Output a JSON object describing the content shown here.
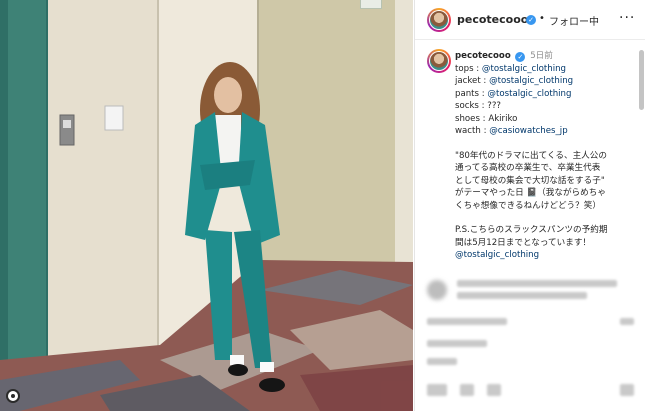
{
  "post": {
    "username": "pecotecooo",
    "follow_separator": "•",
    "follow_label": "フォロー中",
    "more_label": "···",
    "verified_mark": "✓"
  },
  "caption": {
    "username": "pecotecooo",
    "time": "5日前",
    "lines": [
      {
        "key": "tops : ",
        "value": "@tostalgic_clothing"
      },
      {
        "key": "jacket : ",
        "value": "@tostalgic_clothing"
      },
      {
        "key": "pants : ",
        "value": "@tostalgic_clothing"
      },
      {
        "key": "socks : ",
        "value": "???"
      },
      {
        "key": "shoes : ",
        "value": "Akiriko"
      },
      {
        "key": "wacth : ",
        "value": "@casiowatches_jp"
      }
    ],
    "paragraph1": [
      "\"80年代のドラマに出てくる、主人公の",
      "通ってる高校の卒業生で、卒業生代表",
      "として母校の集会で大切な話をする子\"",
      "がテーマやった日 📓（我ながらめちゃ",
      "くちゃ想像できるねんけどどう？笑）"
    ],
    "paragraph2": [
      "P.S.こちらのスラックスパンツの予約期",
      "間は5月12日までとなっています！"
    ],
    "closing_tag": "@tostalgic_clothing"
  },
  "colors": {
    "tag": "#00376b",
    "verified": "#3897f0",
    "outfit": "#1f8e8e"
  }
}
